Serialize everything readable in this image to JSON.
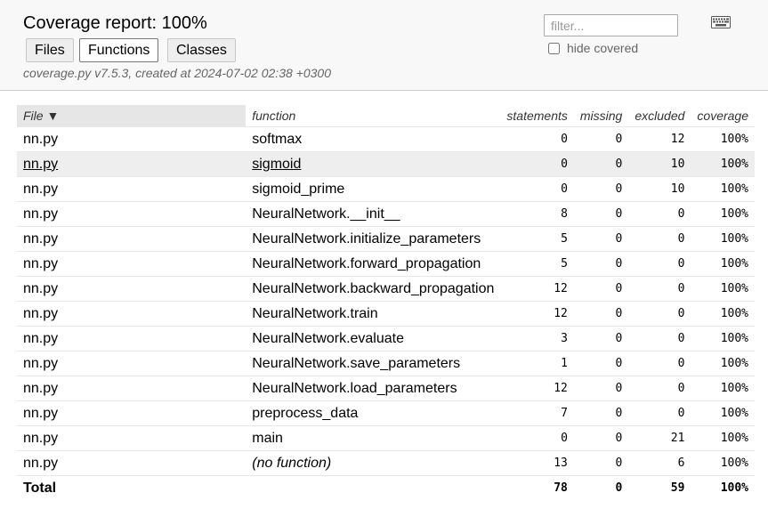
{
  "header": {
    "title": "Coverage report: 100%",
    "tabs": {
      "files": "Files",
      "functions": "Functions",
      "classes": "Classes"
    },
    "meta": "coverage.py v7.5.3, created at 2024-07-02 02:38 +0300",
    "filter_placeholder": "filter...",
    "hide_covered_label": "hide covered",
    "keyboard_icon": "keyboard-icon"
  },
  "table": {
    "columns": {
      "file": "File ▼",
      "function": "function",
      "statements": "statements",
      "missing": "missing",
      "excluded": "excluded",
      "coverage": "coverage"
    },
    "rows": [
      {
        "file": "nn.py",
        "function": "softmax",
        "statements": "0",
        "missing": "0",
        "excluded": "12",
        "coverage": "100%"
      },
      {
        "file": "nn.py",
        "function": "sigmoid",
        "statements": "0",
        "missing": "0",
        "excluded": "10",
        "coverage": "100%"
      },
      {
        "file": "nn.py",
        "function": "sigmoid_prime",
        "statements": "0",
        "missing": "0",
        "excluded": "10",
        "coverage": "100%"
      },
      {
        "file": "nn.py",
        "function": "NeuralNetwork.__init__",
        "statements": "8",
        "missing": "0",
        "excluded": "0",
        "coverage": "100%"
      },
      {
        "file": "nn.py",
        "function": "NeuralNetwork.initialize_parameters",
        "statements": "5",
        "missing": "0",
        "excluded": "0",
        "coverage": "100%"
      },
      {
        "file": "nn.py",
        "function": "NeuralNetwork.forward_propagation",
        "statements": "5",
        "missing": "0",
        "excluded": "0",
        "coverage": "100%"
      },
      {
        "file": "nn.py",
        "function": "NeuralNetwork.backward_propagation",
        "statements": "12",
        "missing": "0",
        "excluded": "0",
        "coverage": "100%"
      },
      {
        "file": "nn.py",
        "function": "NeuralNetwork.train",
        "statements": "12",
        "missing": "0",
        "excluded": "0",
        "coverage": "100%"
      },
      {
        "file": "nn.py",
        "function": "NeuralNetwork.evaluate",
        "statements": "3",
        "missing": "0",
        "excluded": "0",
        "coverage": "100%"
      },
      {
        "file": "nn.py",
        "function": "NeuralNetwork.save_parameters",
        "statements": "1",
        "missing": "0",
        "excluded": "0",
        "coverage": "100%"
      },
      {
        "file": "nn.py",
        "function": "NeuralNetwork.load_parameters",
        "statements": "12",
        "missing": "0",
        "excluded": "0",
        "coverage": "100%"
      },
      {
        "file": "nn.py",
        "function": "preprocess_data",
        "statements": "7",
        "missing": "0",
        "excluded": "0",
        "coverage": "100%"
      },
      {
        "file": "nn.py",
        "function": "main",
        "statements": "0",
        "missing": "0",
        "excluded": "21",
        "coverage": "100%"
      },
      {
        "file": "nn.py",
        "function": "(no function)",
        "statements": "13",
        "missing": "0",
        "excluded": "6",
        "coverage": "100%"
      }
    ],
    "total": {
      "label": "Total",
      "statements": "78",
      "missing": "0",
      "excluded": "59",
      "coverage": "100%"
    }
  }
}
